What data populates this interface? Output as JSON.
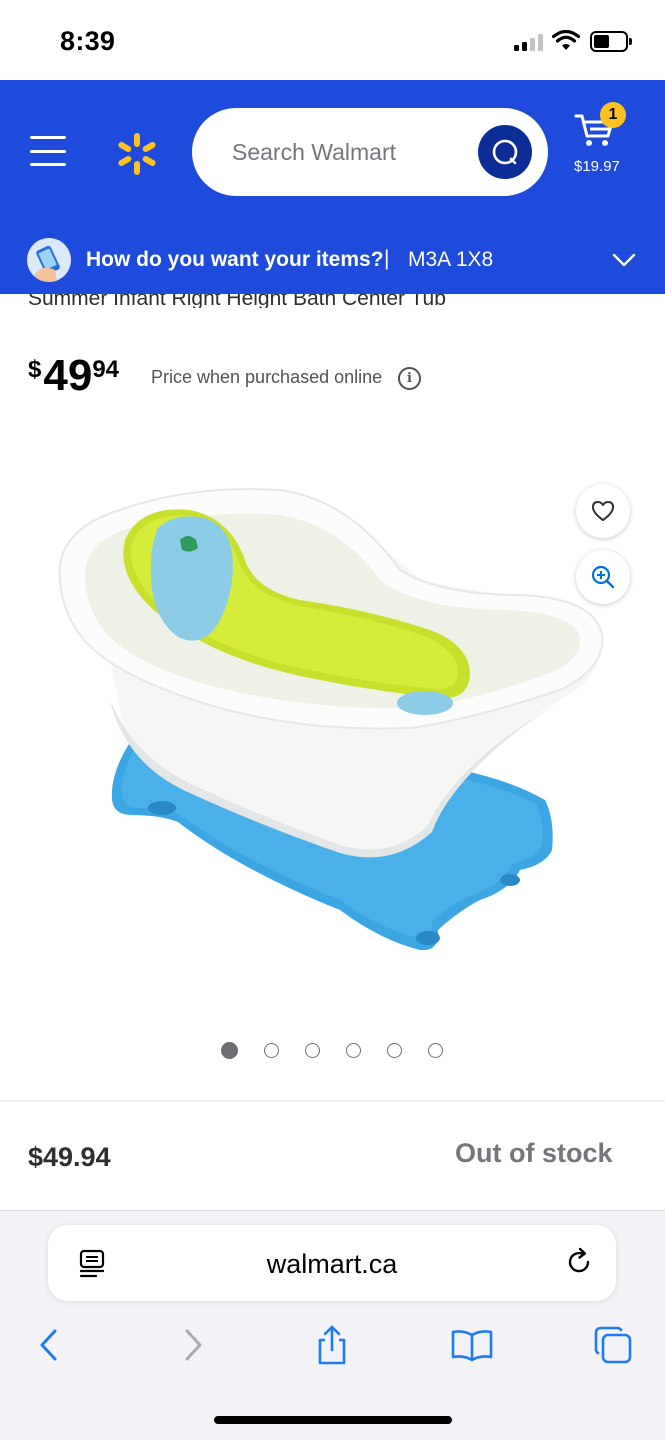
{
  "status_bar": {
    "time": "8:39"
  },
  "header": {
    "search_placeholder": "Search Walmart",
    "cart_count": "1",
    "cart_total": "$19.97",
    "brand_color": "#1e4bdb",
    "accent_color": "#ffc220"
  },
  "delivery": {
    "question": "How do you want your items?",
    "separator": "|",
    "postal_code": "M3A 1X8"
  },
  "product": {
    "title": "Summer Infant Right Height Bath Center Tub",
    "price": {
      "currency": "$",
      "dollars": "49",
      "cents": "94"
    },
    "price_note": "Price when purchased online",
    "image_count": 6,
    "active_image_index": 0
  },
  "purchase_bar": {
    "price": "$49.94",
    "availability": "Out of stock"
  },
  "browser": {
    "url": "walmart.ca"
  },
  "icons": {
    "menu": "hamburger-icon",
    "logo": "walmart-spark-logo",
    "search": "search-icon",
    "cart": "cart-icon",
    "favorite": "heart-icon",
    "zoom": "zoom-in-icon",
    "info": "info-icon",
    "reader": "reader-mode-icon",
    "reload": "reload-icon",
    "back": "back-icon",
    "forward": "forward-icon",
    "share": "share-icon",
    "bookmarks": "bookmarks-icon",
    "tabs": "tabs-icon"
  }
}
